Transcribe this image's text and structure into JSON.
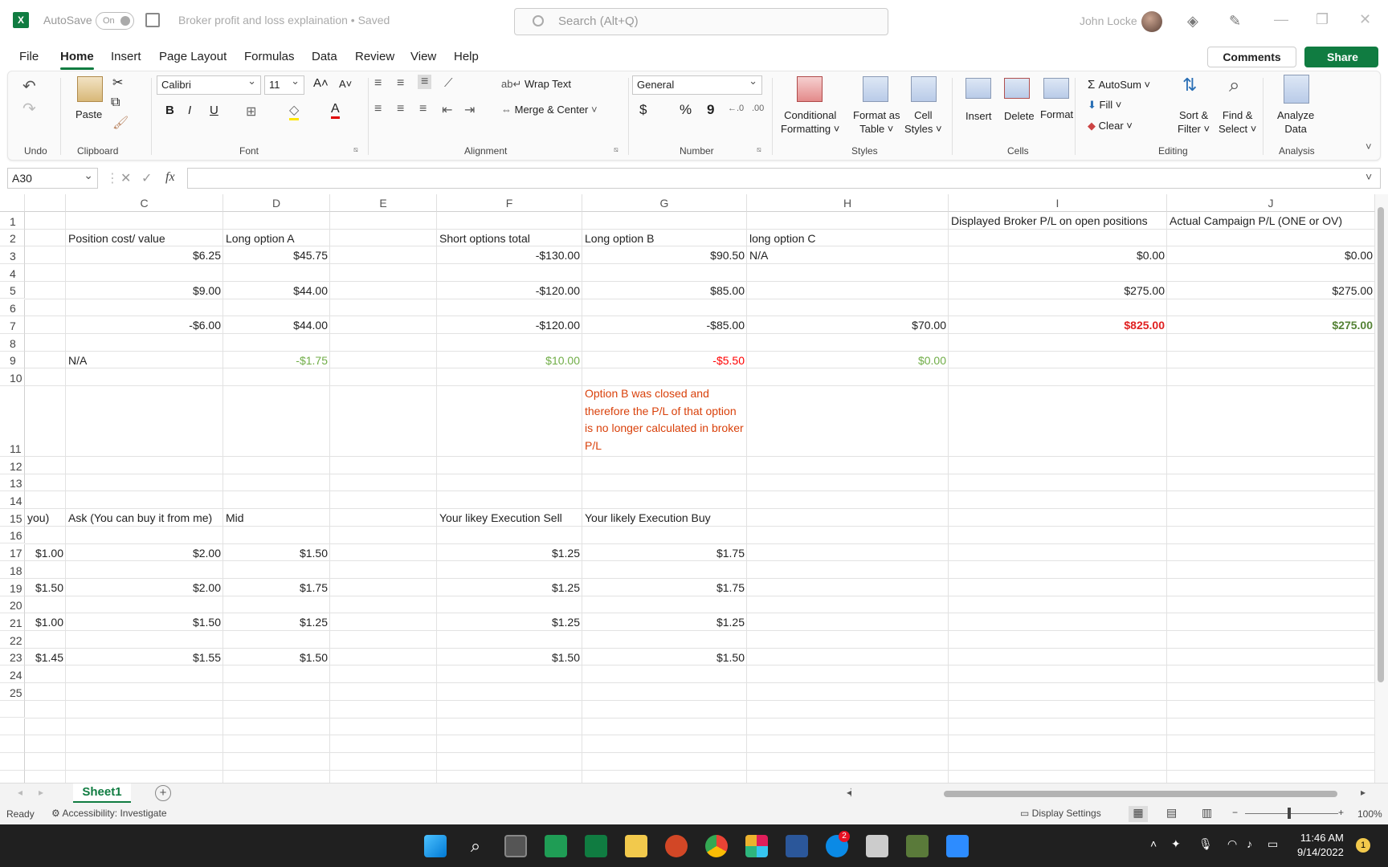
{
  "window": {
    "app_icon": "X",
    "autosave_label": "AutoSave",
    "autosave_state": "On",
    "doc_title": "Broker profit and loss explaination • Saved",
    "search_placeholder": "Search (Alt+Q)",
    "user_name": "John Locke"
  },
  "menu": {
    "tabs": [
      "File",
      "Home",
      "Insert",
      "Page Layout",
      "Formulas",
      "Data",
      "Review",
      "View",
      "Help"
    ],
    "comments": "Comments",
    "share": "Share"
  },
  "ribbon": {
    "undo_label": "Undo",
    "clipboard_label": "Clipboard",
    "paste": "Paste",
    "font_label": "Font",
    "font_name": "Calibri",
    "font_size": "11",
    "bold": "B",
    "italic": "I",
    "underline": "U",
    "alignment_label": "Alignment",
    "wrap_text": "Wrap Text",
    "merge_center": "Merge & Center",
    "number_label": "Number",
    "number_format": "General",
    "currency": "$",
    "percent": "%",
    "comma": "9",
    "styles_label": "Styles",
    "cond_fmt_1": "Conditional",
    "cond_fmt_2": "Formatting",
    "fmt_table_1": "Format as",
    "fmt_table_2": "Table",
    "cell_styles_1": "Cell",
    "cell_styles_2": "Styles",
    "cells_label": "Cells",
    "insert": "Insert",
    "delete": "Delete",
    "format": "Format",
    "editing_label": "Editing",
    "autosum": "AutoSum",
    "fill": "Fill",
    "clear": "Clear",
    "sort_1": "Sort &",
    "sort_2": "Filter",
    "find_1": "Find &",
    "find_2": "Select",
    "analysis_label": "Analysis",
    "analyze_1": "Analyze",
    "analyze_2": "Data"
  },
  "formula": {
    "namebox": "A30",
    "fx": "fx",
    "value": ""
  },
  "grid": {
    "columns": [
      "C",
      "D",
      "E",
      "F",
      "G",
      "H",
      "I",
      "J"
    ],
    "rows": [
      "1",
      "2",
      "3",
      "4",
      "5",
      "6",
      "7",
      "8",
      "9",
      "10",
      "11",
      "12",
      "13",
      "14",
      "15",
      "16",
      "17",
      "18",
      "19",
      "20",
      "21",
      "22",
      "23",
      "24",
      "25"
    ],
    "cells": {
      "I1": "Displayed Broker  P/L on open positions",
      "J1": "Actual Campaign P/L  (ONE or OV)",
      "C2": "Position cost/ value",
      "D2": "Long option A",
      "F2": "Short options total",
      "G2": "Long option B",
      "H2": "long option C",
      "C3": "$6.25",
      "D3": "$45.75",
      "F3": "-$130.00",
      "G3": "$90.50",
      "H3": "N/A",
      "I3": "$0.00",
      "J3": "$0.00",
      "C5": "$9.00",
      "D5": "$44.00",
      "F5": "-$120.00",
      "G5": "$85.00",
      "I5": "$275.00",
      "J5": "$275.00",
      "C7": "-$6.00",
      "D7": "$44.00",
      "F7": "-$120.00",
      "G7": "-$85.00",
      "H7": "$70.00",
      "I7": "$825.00",
      "J7": "$275.00",
      "C9": "N/A",
      "D9": "-$1.75",
      "F9": "$10.00",
      "G9": "-$5.50",
      "H9": "$0.00",
      "G11": "Option B was closed and therefore the P/L of that option is no longer calculated in broker P/L",
      "B15": "you)",
      "C15": "Ask (You can buy it from me)",
      "D15": "Mid",
      "F15": "Your likey Execution Sell",
      "G15": "Your likely Execution Buy",
      "B17": "$1.00",
      "C17": "$2.00",
      "D17": "$1.50",
      "F17": "$1.25",
      "G17": "$1.75",
      "B19": "$1.50",
      "C19": "$2.00",
      "D19": "$1.75",
      "F19": "$1.25",
      "G19": "$1.75",
      "B21": "$1.00",
      "C21": "$1.50",
      "D21": "$1.25",
      "F21": "$1.25",
      "G21": "$1.25",
      "B23": "$1.45",
      "C23": "$1.55",
      "D23": "$1.50",
      "F23": "$1.50",
      "G23": "$1.50"
    }
  },
  "sheets": {
    "active": "Sheet1"
  },
  "status": {
    "ready": "Ready",
    "accessibility": "Accessibility: Investigate",
    "display_settings": "Display Settings",
    "zoom": "100%"
  },
  "taskbar": {
    "time": "11:46 AM",
    "date": "9/14/2022",
    "notif_count": "2"
  },
  "colors": {
    "accent": "#107c41",
    "note": "#d9410b",
    "positive": "#70ad47",
    "negative": "#ff0000"
  }
}
